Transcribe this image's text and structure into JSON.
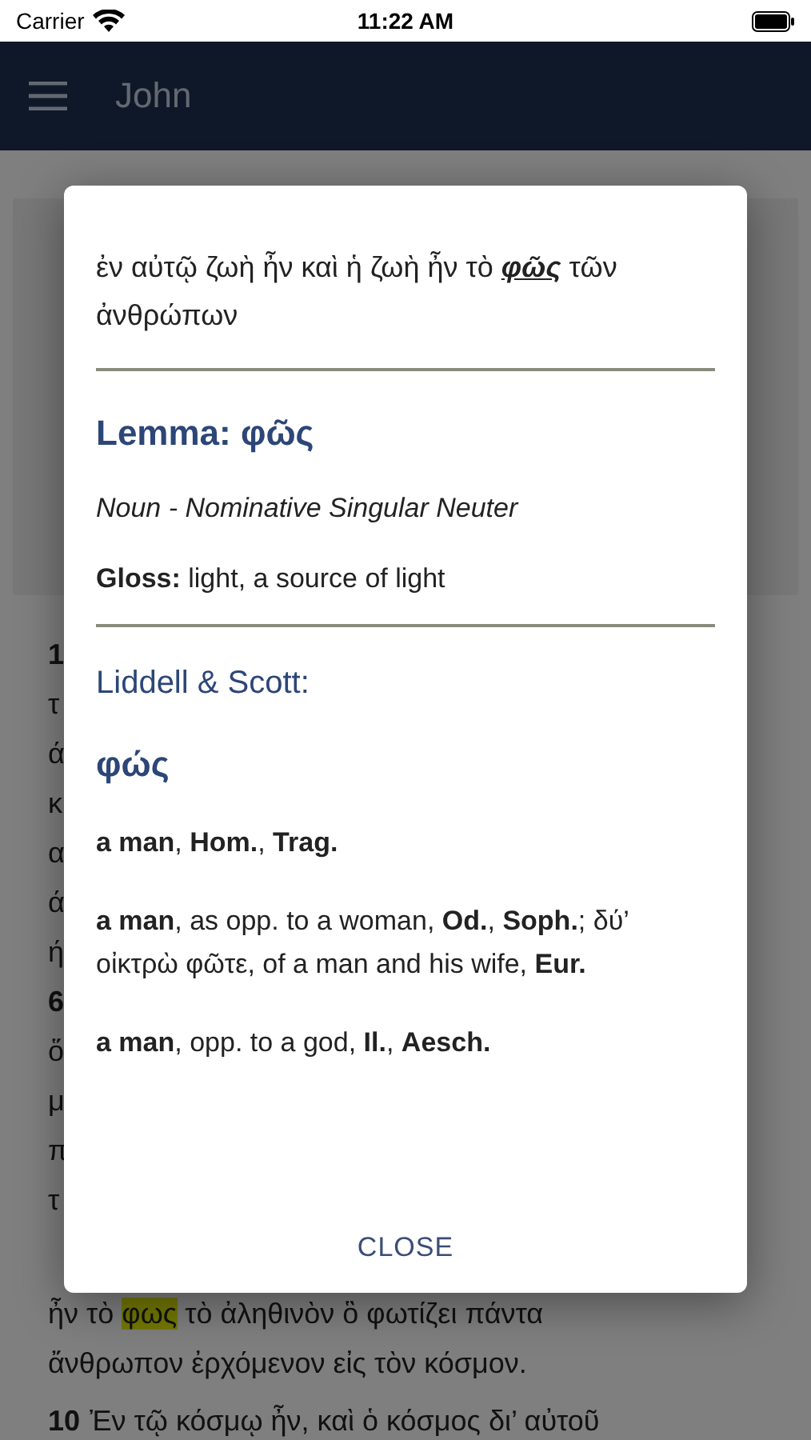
{
  "status_bar": {
    "carrier": "Carrier",
    "time": "11:22 AM"
  },
  "nav": {
    "title": "John"
  },
  "background_lines": [
    {
      "kind": "number",
      "text": "1"
    },
    {
      "kind": "text",
      "text": "τ"
    },
    {
      "kind": "text",
      "text": "ά"
    },
    {
      "kind": "text",
      "text": "κ"
    },
    {
      "kind": "text",
      "text": "α"
    },
    {
      "kind": "text",
      "text": "ά"
    },
    {
      "kind": "text",
      "text": "ή"
    },
    {
      "kind": "number",
      "text": "6"
    },
    {
      "kind": "text",
      "text": "ὅ"
    },
    {
      "kind": "text",
      "text": "μ"
    },
    {
      "kind": "text",
      "text": "π"
    },
    {
      "kind": "text",
      "text": "τ"
    }
  ],
  "background_after": [
    {
      "kind": "highlight",
      "before": "ἦν τὸ",
      "word": "φως",
      "after": "τὸ ἀληθινὸν ὃ φωτίζει πάντα"
    },
    {
      "kind": "text",
      "text": "ἄνθρωπον ἐρχόμενον εἰς τὸν κόσμον."
    },
    {
      "kind": "verse",
      "number": "10",
      "text": "Ἐν τῷ κόσμῳ ἦν, καὶ ὁ κόσμος δι’ αὐτοῦ"
    }
  ],
  "dialog": {
    "sentence": {
      "before": "ἐν αὐτῷ ζωὴ ἦν καὶ ἡ ζωὴ ἦν τὸ",
      "word": "φῶς",
      "after": "τῶν ἀνθρώπων"
    },
    "lemma": "Lemma: φῶς",
    "parsing": "Noun - Nominative Singular Neuter",
    "gloss": "**Gloss:** light, a source of light",
    "lexicon_title": "Liddell & Scott:",
    "headword": "φώς",
    "entries": [
      "**a man**, **Hom.**, **Trag.**",
      "**a man**, as opp. to a woman, **Od.**, **Soph.**; δύ’ οἰκτρὼ φῶτε, of a man and his wife, **Eur.**",
      "**a man**, opp. to a god, **Il.**, **Aesch.**"
    ],
    "close": "CLOSE"
  }
}
